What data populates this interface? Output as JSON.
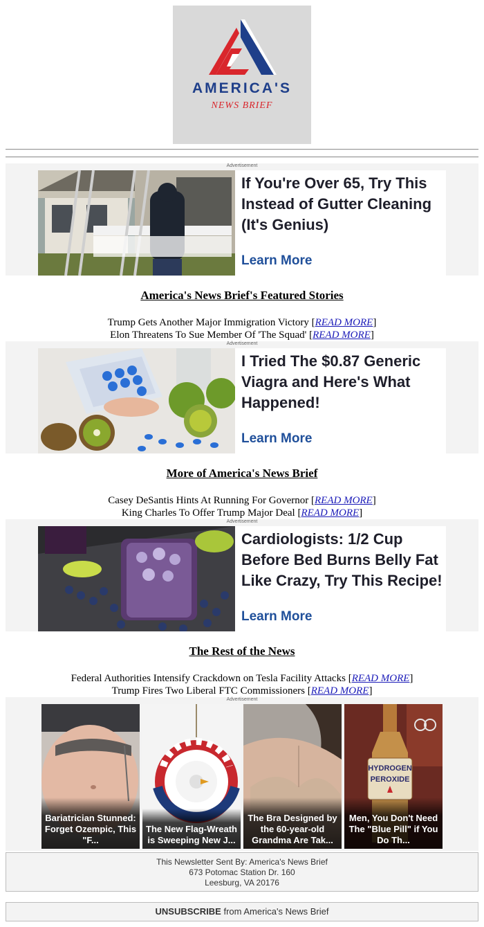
{
  "brand": {
    "name_line1": "AMERICA'S",
    "name_line2": "NEWS BRIEF",
    "colors": {
      "navy": "#1f3f8a",
      "red": "#d9262c"
    }
  },
  "ads": [
    {
      "label": "Advertisement",
      "headline": "If You're Over 65, Try This Instead of Gutter Cleaning (It's Genius)",
      "cta": "Learn More",
      "image": "man-carrying-gutter-guard-photo"
    },
    {
      "label": "Advertisement",
      "headline": "I Tried The $0.87 Generic Viagra and Here's What Happened!",
      "cta": "Learn More",
      "image": "blue-pills-and-kiwi-photo"
    },
    {
      "label": "Advertisement",
      "headline": "Cardiologists: 1/2 Cup Before Bed Burns Belly Fat Like Crazy, Try This Recipe!",
      "cta": "Learn More",
      "image": "blueberry-drink-photo"
    }
  ],
  "sections": [
    {
      "title": "America's News Brief's Featured Stories",
      "stories": [
        {
          "text": "Trump Gets Another Major Immigration Victory",
          "link": "READ MORE"
        },
        {
          "text": "Elon Threatens To Sue Member Of 'The Squad'",
          "link": "READ MORE"
        }
      ]
    },
    {
      "title": "More of America's News Brief",
      "stories": [
        {
          "text": "Casey DeSantis Hints At Running For Governor",
          "link": "READ MORE"
        },
        {
          "text": "King Charles To Offer Trump Major Deal",
          "link": "READ MORE"
        }
      ]
    },
    {
      "title": "The Rest of the News",
      "stories": [
        {
          "text": "Federal Authorities Intensify Crackdown on Tesla Facility Attacks",
          "link": "READ MORE"
        },
        {
          "text": "Trump Fires Two Liberal FTC Commissioners",
          "link": "READ MORE"
        }
      ]
    }
  ],
  "grid_ad": {
    "label": "Advertisement",
    "tiles": [
      {
        "caption": "Bariatrician Stunned: Forget Ozempic, This \"F...",
        "image": "belly-photo"
      },
      {
        "caption": "The New Flag-Wreath is Sweeping New J...",
        "image": "flag-wreath-photo"
      },
      {
        "caption": "The Bra Designed by the 60-year-old Grandma Are Tak...",
        "image": "bra-photo"
      },
      {
        "caption": "Men, You Don't Need The \"Blue Pill\" if You Do Th...",
        "image": "hydrogen-peroxide-photo",
        "bottle_text": "HYDROGEN PEROXIDE"
      }
    ]
  },
  "footer": {
    "line1": "This Newsletter Sent By: America's News Brief",
    "line2": "673 Potomac Station Dr. 160",
    "line3": "Leesburg, VA 20176"
  },
  "unsubscribe": {
    "action": "UNSUBSCRIBE",
    "rest": " from America's News Brief"
  }
}
